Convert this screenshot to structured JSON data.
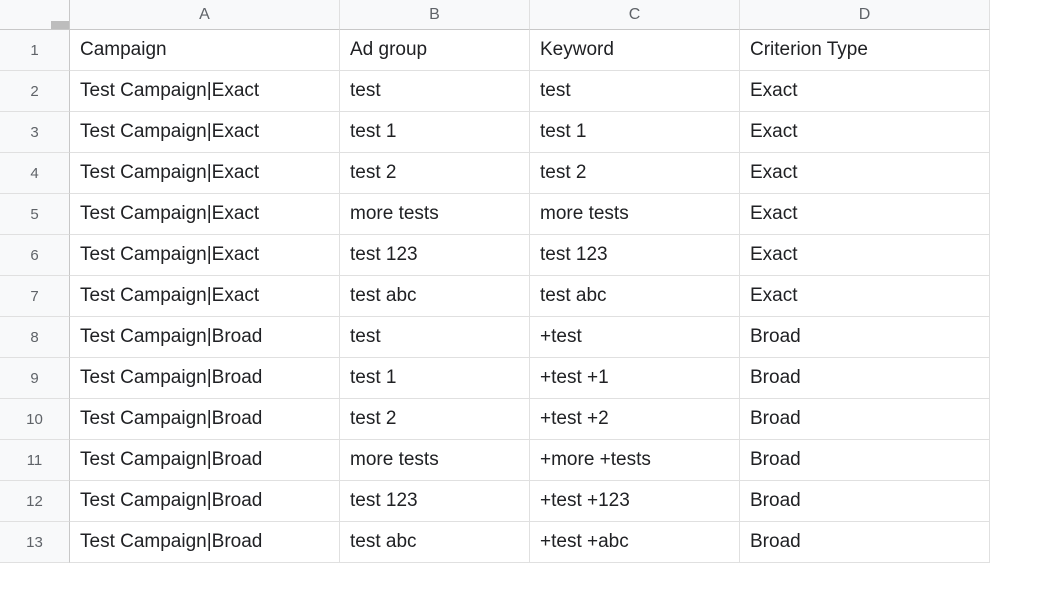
{
  "columns": [
    "A",
    "B",
    "C",
    "D"
  ],
  "row_numbers": [
    "1",
    "2",
    "3",
    "4",
    "5",
    "6",
    "7",
    "8",
    "9",
    "10",
    "11",
    "12",
    "13"
  ],
  "chart_data": {
    "type": "table",
    "headers": [
      "Campaign",
      "Ad group",
      "Keyword",
      "Criterion Type"
    ],
    "rows": [
      [
        "Test Campaign|Exact",
        "test",
        "test",
        "Exact"
      ],
      [
        "Test Campaign|Exact",
        "test 1",
        "test 1",
        "Exact"
      ],
      [
        "Test Campaign|Exact",
        "test 2",
        "test 2",
        "Exact"
      ],
      [
        "Test Campaign|Exact",
        "more tests",
        "more tests",
        "Exact"
      ],
      [
        "Test Campaign|Exact",
        "test 123",
        "test 123",
        "Exact"
      ],
      [
        "Test Campaign|Exact",
        "test abc",
        "test abc",
        "Exact"
      ],
      [
        "Test Campaign|Broad",
        "test",
        "+test",
        "Broad"
      ],
      [
        "Test Campaign|Broad",
        "test 1",
        "+test +1",
        "Broad"
      ],
      [
        "Test Campaign|Broad",
        "test 2",
        "+test +2",
        "Broad"
      ],
      [
        "Test Campaign|Broad",
        "more tests",
        "+more +tests",
        "Broad"
      ],
      [
        "Test Campaign|Broad",
        "test 123",
        "+test +123",
        "Broad"
      ],
      [
        "Test Campaign|Broad",
        "test abc",
        "+test +abc",
        "Broad"
      ]
    ]
  }
}
